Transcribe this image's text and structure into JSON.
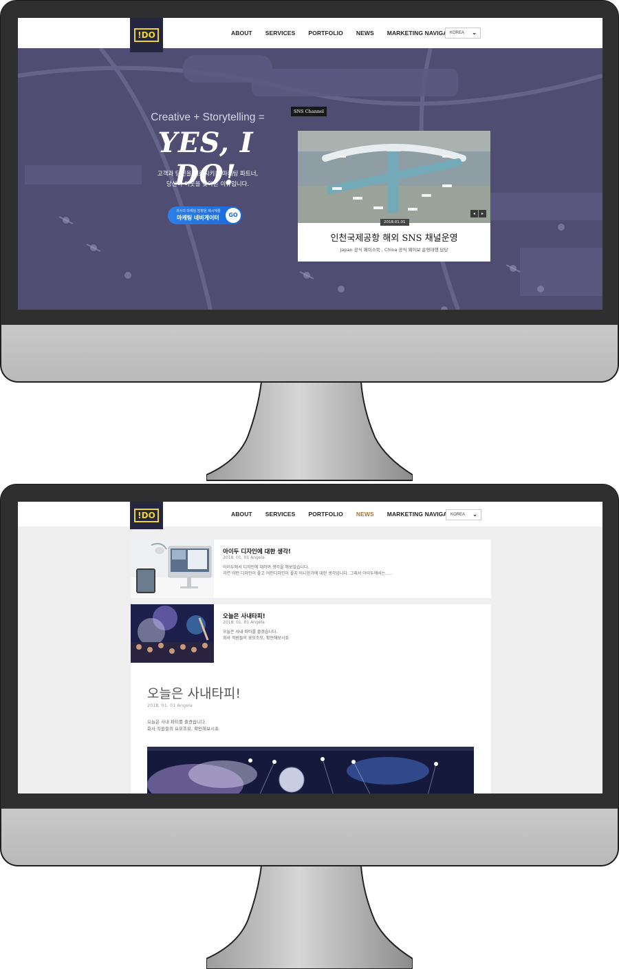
{
  "nav": {
    "logo": "!DO",
    "items": [
      "ABOUT",
      "SERVICES",
      "PORTFOLIO",
      "NEWS",
      "MARKETING NAVIGATION"
    ],
    "language": "KOREA",
    "active_item_screen2": "NEWS"
  },
  "hero": {
    "tagline": "Creative + Storytelling =",
    "headline": "YES, I DO!",
    "desc_line1": "고객과 당신을 매료시키는 마케팅 파트너,",
    "desc_line2": "당신이 이곳을 찾아온 이유입니다.",
    "button_small": "귀사의 마케팅 방향을 제시해줄",
    "button_label": "마케팅 네비게이터",
    "button_go": "GO"
  },
  "sns_card": {
    "label": "SNS Channel",
    "date": "2018.01.01",
    "title": "인천국제공항 해외 SNS 채널운영",
    "subtitle": "Japan 공식 페이스북 , China 공식 웨이보 운영대행 담당",
    "prev": "◂",
    "next": "▸"
  },
  "news": [
    {
      "title": "아이두 디자인에 대한 생각!",
      "meta": "2018. 01. 01 Angela",
      "body_line1": "아이두에서 디자인에 대하여 생각을 해보았습니다.",
      "body_line2": "과연 어떤 디자인이 좋고 어떤디자인이 좋지 아니한가에 대한 생각입니다. 그래서 아이두에서는....."
    },
    {
      "title": "오늘은 사내타피!",
      "meta": "2018. 01. 01 Angela",
      "body_line1": "오늘은 사내 파티를 즐겼습니다.",
      "body_line2": "회사 직원들의 요모조모, 확인해보시죠"
    }
  ],
  "article": {
    "title": "오늘은 사내타피!",
    "meta": "2018. 01. 01 Angela",
    "body_line1": "오늘은 사내 파티를 즐겼습니다.",
    "body_line2": "회사 직원들의 요모조모, 확인해보시죠"
  },
  "colors": {
    "bezel": "#2f2f2f",
    "chin": "#c4c4c4",
    "hero_overlay": "#4f4d72",
    "logo_bg": "#252640",
    "logo_accent": "#f1d52a",
    "active_nav": "#a5763e",
    "go_button": "#1a68d6"
  }
}
